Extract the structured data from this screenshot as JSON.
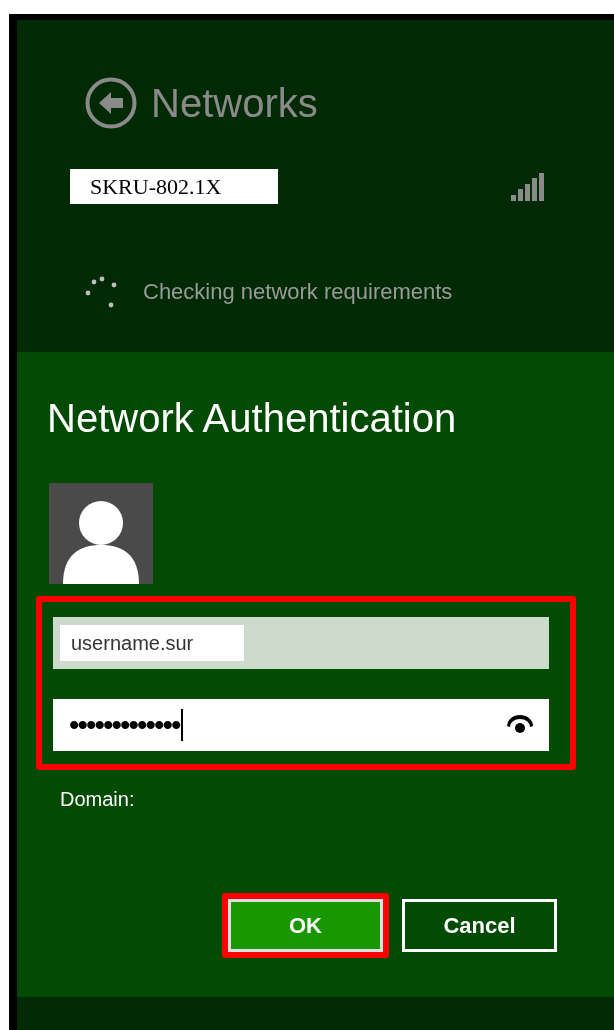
{
  "header": {
    "title": "Networks"
  },
  "network": {
    "ssid": "SKRU-802.1X",
    "status": "Checking network requirements"
  },
  "dialog": {
    "title": "Network Authentication",
    "credentials": {
      "highlighted": true,
      "username": "username.sur",
      "password": "•••••••••••••",
      "password_focused": true
    },
    "domain_label": "Domain:",
    "buttons": [
      {
        "kind": "primary",
        "label": "OK",
        "highlighted": true
      },
      {
        "kind": "secondary",
        "label": "Cancel",
        "highlighted": false
      }
    ]
  }
}
